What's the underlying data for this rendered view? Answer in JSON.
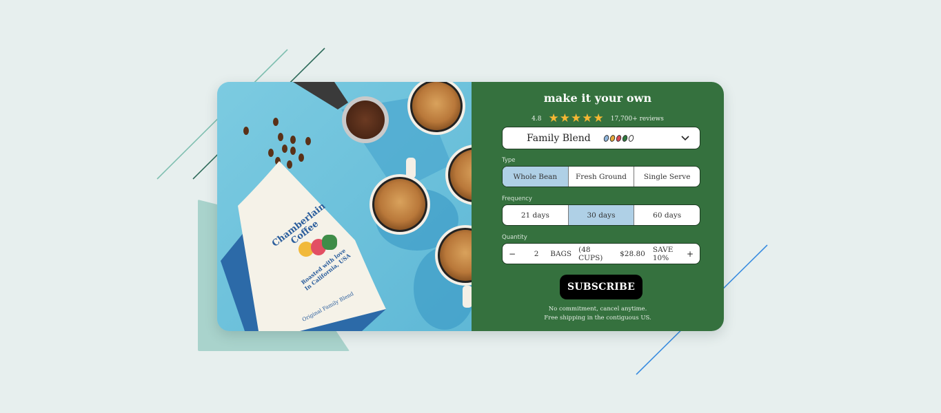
{
  "product": {
    "heading": "make it your own",
    "rating": {
      "score": "4.8",
      "stars": 5,
      "reviews": "17,700+ reviews"
    },
    "blend_select": {
      "selected": "Family Blend",
      "bean_colors": [
        "#8fb6dc",
        "#e6a93a",
        "#d94a55",
        "#2f7a3d",
        "#ffffff"
      ]
    },
    "type": {
      "label": "Type",
      "options": [
        "Whole Bean",
        "Fresh Ground",
        "Single Serve"
      ],
      "selected": "Whole Bean"
    },
    "frequency": {
      "label": "Frequency",
      "options": [
        "21 days",
        "30 days",
        "60 days"
      ],
      "selected": "30 days"
    },
    "quantity": {
      "label": "Quantity",
      "decrement": "−",
      "value": "2",
      "unit": "BAGS",
      "cups": "(48 CUPS)",
      "price": "$28.80",
      "savings": "SAVE 10%",
      "increment": "+"
    },
    "subscribe_label": "SUBSCRIBE",
    "notes": [
      "No commitment, cancel anytime.",
      "Free shipping in the contiguous US."
    ]
  },
  "photo": {
    "bag_brand": "Chamberlain Coffee",
    "bag_tagline": "Roasted with love In California, USA",
    "bag_product": "Original Family Blend"
  },
  "colors": {
    "panel_green": "#35713e",
    "selected_option": "#afd0e6",
    "star": "#f6b733",
    "background": "#e7efee"
  }
}
